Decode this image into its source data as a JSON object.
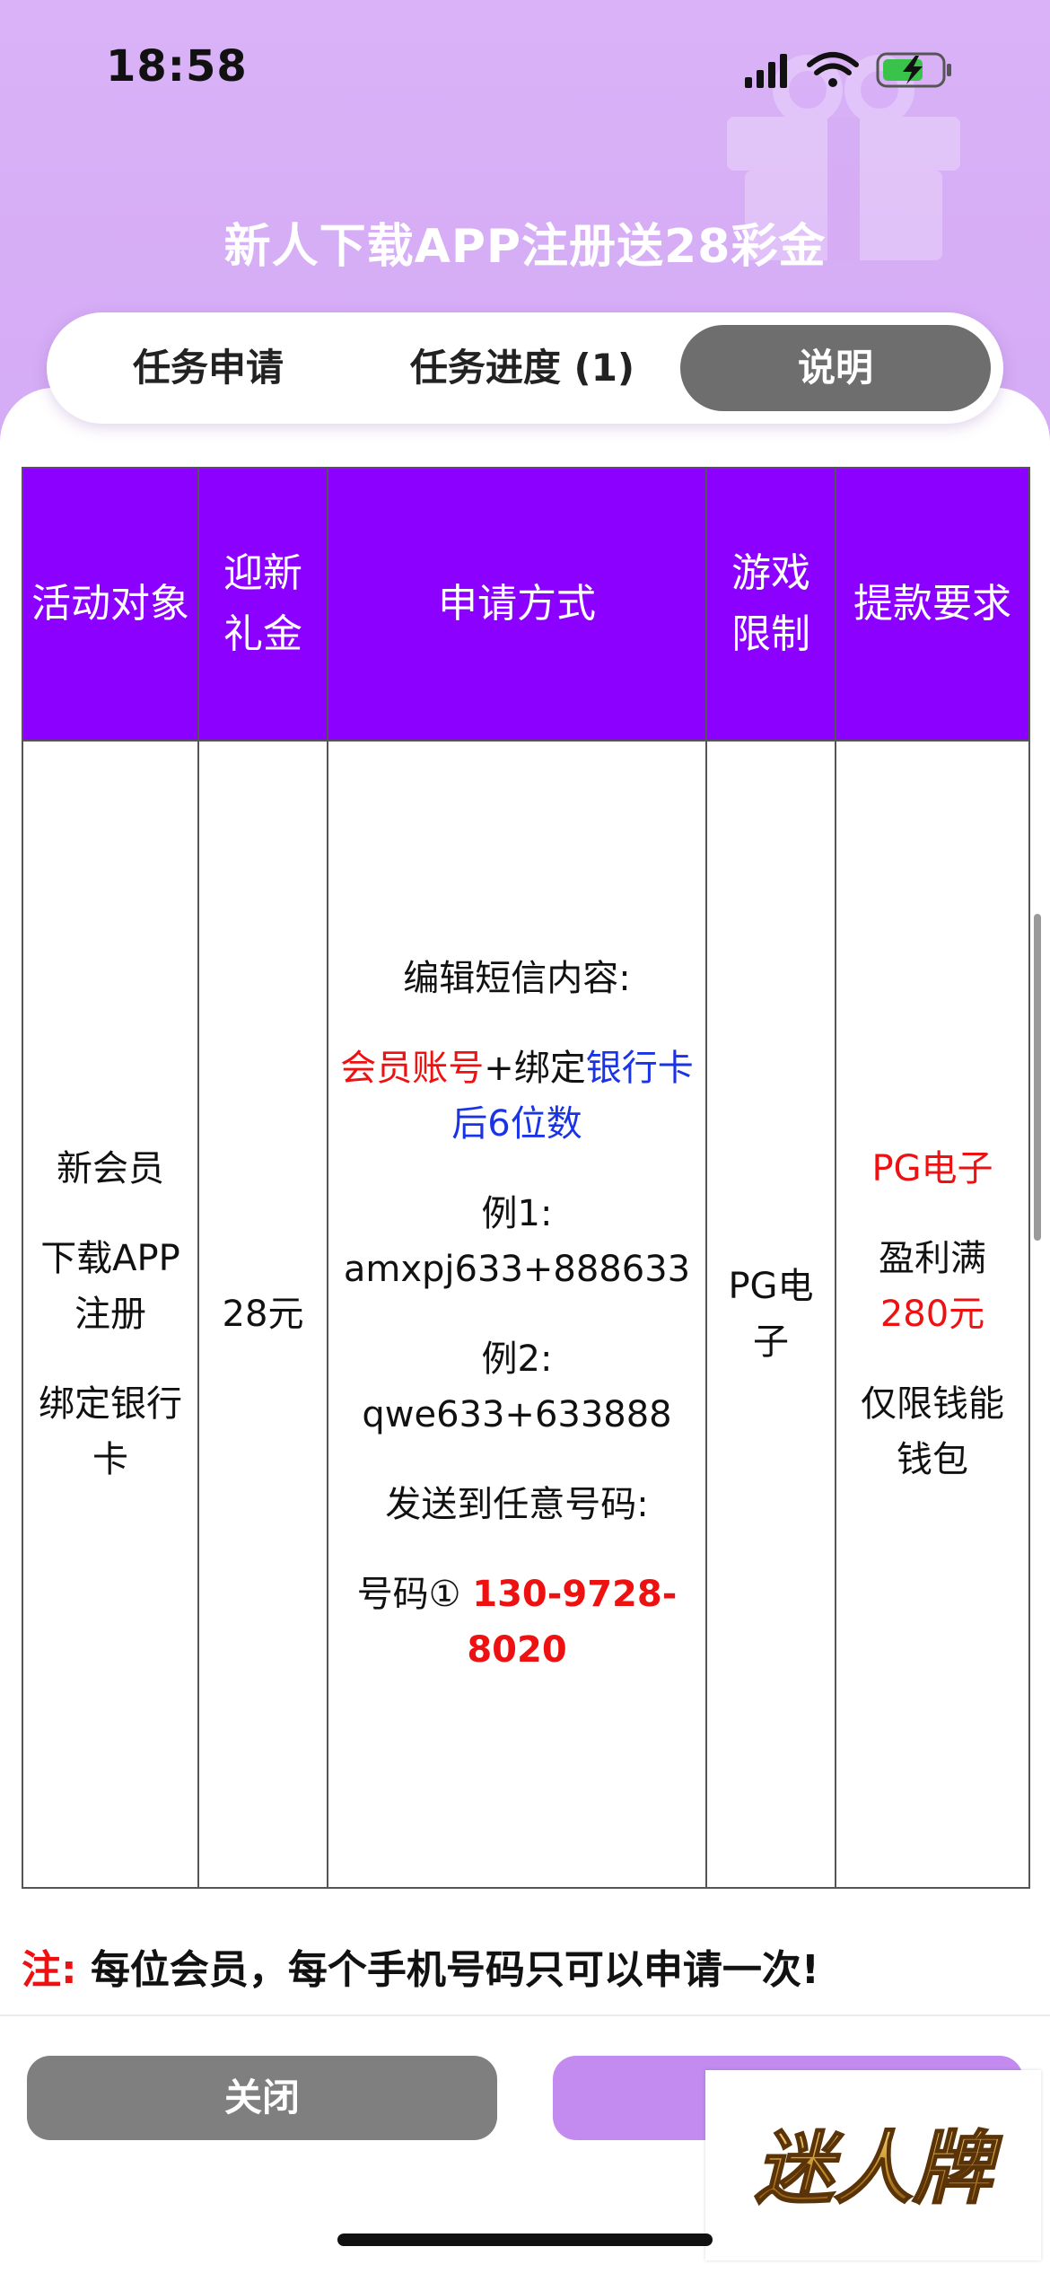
{
  "status_bar": {
    "time": "18:58"
  },
  "header": {
    "title": "新人下载APP注册送28彩金"
  },
  "tabs": [
    {
      "label": "任务申请"
    },
    {
      "label": "任务进度 (1)"
    },
    {
      "label": "说明",
      "active": true
    }
  ],
  "table": {
    "headers": {
      "target": "活动对象",
      "bonus": "迎新礼金",
      "method": "申请方式",
      "game": "游戏限制",
      "withdraw": "提款要求"
    },
    "target_lines": [
      "新会员",
      "下载APP注册",
      "绑定银行卡"
    ],
    "bonus": "28元",
    "method": {
      "intro": "编辑短信内容:",
      "format_red": "会员账号",
      "format_plus": "+绑定",
      "format_blue": "银行卡后6位数",
      "example1_label": "例1:",
      "example1_value": "amxpj633+888633",
      "example2_label": "例2:",
      "example2_value": "qwe633+633888",
      "send_to": "发送到任意号码:",
      "number_label": "号码①",
      "number_value": "130-9728-8020"
    },
    "game": "PG电子",
    "withdraw": {
      "game": "PG电子",
      "profit_label": "盈利满",
      "profit_value": "280元",
      "wallet": "仅限钱能钱包"
    }
  },
  "note": {
    "label": "注:",
    "text": "每位会员，每个手机号码只可以申请一次!"
  },
  "buttons": {
    "close": "关闭"
  },
  "logo_text": "迷人牌",
  "colors": {
    "header": "#d9b2f7",
    "table_header": "#8b00ff",
    "red": "#ee1111",
    "blue": "#1a33e6",
    "active_tab": "#6e6e6e"
  }
}
